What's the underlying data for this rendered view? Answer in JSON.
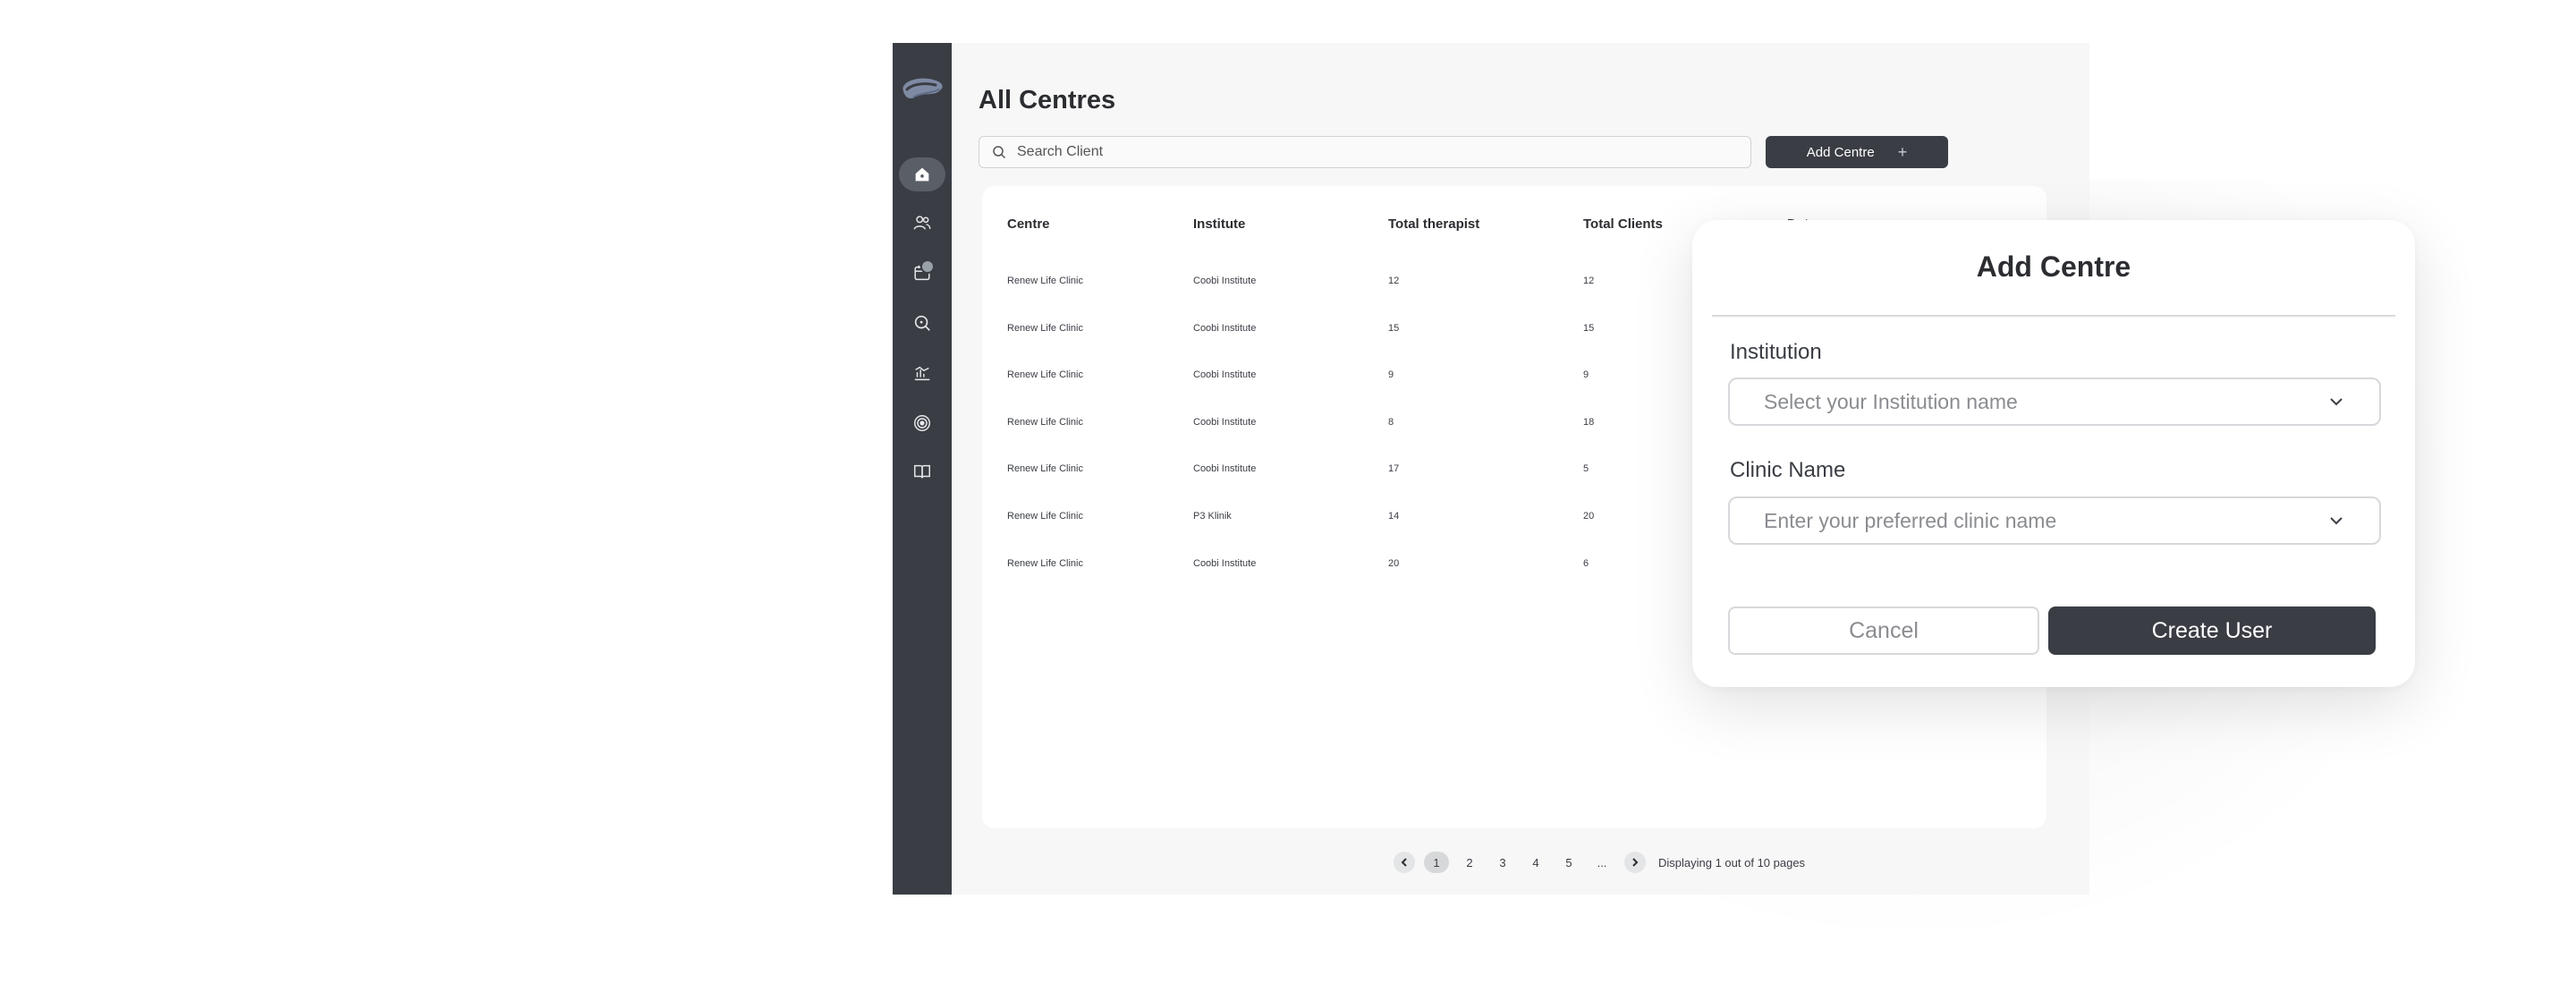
{
  "page": {
    "title": "All Centres",
    "search_placeholder": "Search Client",
    "add_button_label": "Add Centre",
    "add_button_icon": "plus-icon"
  },
  "sidebar": {
    "items": [
      {
        "name": "home",
        "icon": "home-icon",
        "active": true
      },
      {
        "name": "users",
        "icon": "users-icon",
        "active": false
      },
      {
        "name": "calendar",
        "icon": "calendar-icon",
        "active": false,
        "badge": true
      },
      {
        "name": "search",
        "icon": "search-icon",
        "active": false
      },
      {
        "name": "analytics",
        "icon": "chart-icon",
        "active": false
      },
      {
        "name": "goals",
        "icon": "target-icon",
        "active": false
      },
      {
        "name": "library",
        "icon": "book-icon",
        "active": false
      }
    ]
  },
  "table": {
    "headers": [
      "Centre",
      "Institute",
      "Total therapist",
      "Total Clients",
      "Date"
    ],
    "rows": [
      [
        "Renew Life Clinic",
        "Coobi Institute",
        "12",
        "12"
      ],
      [
        "Renew Life Clinic",
        "Coobi Institute",
        "15",
        "15"
      ],
      [
        "Renew Life Clinic",
        "Coobi Institute",
        "9",
        "9"
      ],
      [
        "Renew Life Clinic",
        "Coobi Institute",
        "8",
        "18"
      ],
      [
        "Renew Life Clinic",
        "Coobi Institute",
        "17",
        "5"
      ],
      [
        "Renew Life Clinic",
        "P3 Klinik",
        "14",
        "20"
      ],
      [
        "Renew Life Clinic",
        "Coobi Institute",
        "20",
        "6"
      ]
    ]
  },
  "pagination": {
    "pages": [
      "1",
      "2",
      "3",
      "4",
      "5",
      "..."
    ],
    "current": "1",
    "info": "Displaying 1 out of 10 pages"
  },
  "modal": {
    "title": "Add Centre",
    "institution_label": "Institution",
    "institution_placeholder": "Select your Institution name",
    "clinic_label": "Clinic Name",
    "clinic_placeholder": "Enter your preferred clinic name",
    "cancel_label": "Cancel",
    "submit_label": "Create User"
  },
  "colors": {
    "sidebar": "#3a3d44",
    "primary_button": "#3a3d44",
    "background": "#f7f7f7",
    "card": "#ffffff"
  }
}
